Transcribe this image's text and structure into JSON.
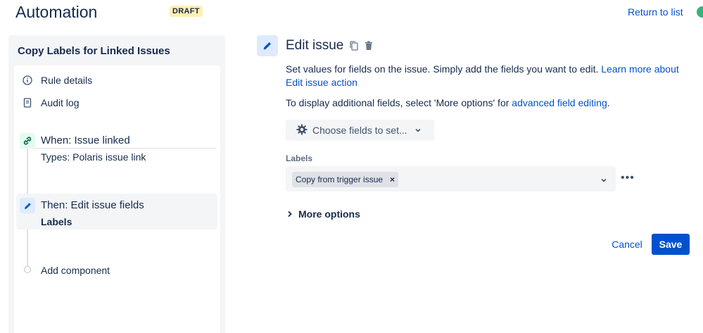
{
  "header": {
    "title": "Automation",
    "badge": "DRAFT",
    "return_link": "Return to list"
  },
  "sidebar": {
    "rule_name": "Copy Labels for Linked Issues",
    "nav": [
      {
        "label": "Rule details",
        "icon": "info-icon"
      },
      {
        "label": "Audit log",
        "icon": "document-icon"
      }
    ],
    "steps": [
      {
        "title": "When: Issue linked",
        "subtitle": "Types: Polaris issue link",
        "icon": "link-icon"
      },
      {
        "title": "Then: Edit issue fields",
        "subtitle": "Labels",
        "icon": "pencil-icon"
      }
    ],
    "add_component": "Add component"
  },
  "main": {
    "title": "Edit issue",
    "description": "Set values for fields on the issue. Simply add the fields you want to edit.",
    "description_link": "Learn more about Edit issue action",
    "additional_text": "To display additional fields, select 'More options' for",
    "additional_link": "advanced field editing",
    "additional_end": ".",
    "choose_fields": "Choose fields to set...",
    "field_label": "Labels",
    "tag_value": "Copy from trigger issue",
    "tag_remove": "×",
    "more_menu": "•••",
    "more_options": "More options",
    "cancel": "Cancel",
    "save": "Save"
  },
  "colors": {
    "primary": "#0052cc",
    "draft_badge": "#fff0b3",
    "step_link_bg": "#e3fcef",
    "step_edit_bg": "#deebff"
  }
}
